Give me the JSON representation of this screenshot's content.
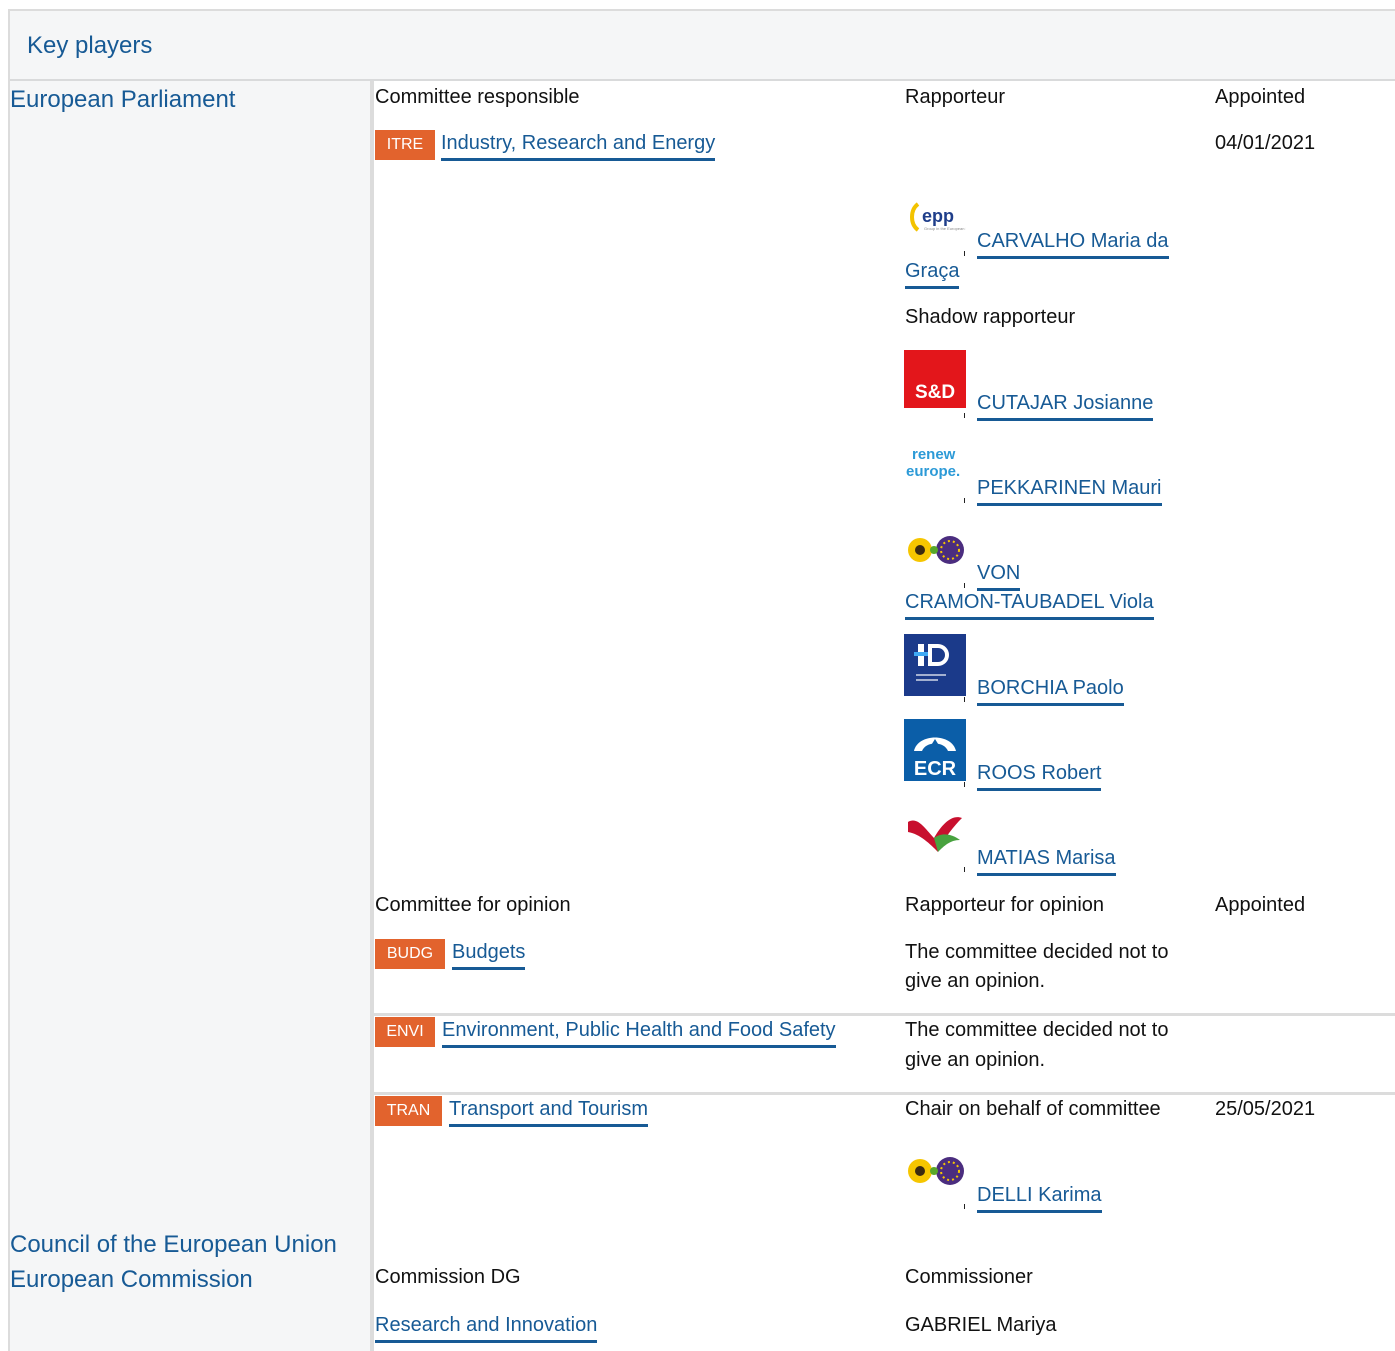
{
  "section": {
    "title": "Key players"
  },
  "bodies": {
    "ep": "European Parliament",
    "council": "Council of the European Union",
    "commission": "European Commission"
  },
  "responsible": {
    "headers": {
      "committee": "Committee responsible",
      "rapporteur": "Rapporteur",
      "appointed": "Appointed"
    },
    "committee": {
      "code": "ITRE",
      "name": "Industry, Research and Energy",
      "appointed": "04/01/2021"
    },
    "rapporteur": {
      "group": "epp-logo",
      "name_line1": "CARVALHO Maria da",
      "name_line2": "Graça"
    },
    "shadow_label": "Shadow rapporteur",
    "shadows": [
      {
        "group": "sd-logo",
        "logo_text": "S&D",
        "name": "CUTAJAR Josianne"
      },
      {
        "group": "renew-europe-logo",
        "logo_text_1": "renew",
        "logo_text_2": "europe.",
        "name": "PEKKARINEN Mauri"
      },
      {
        "group": "greens-efa-logo",
        "name_line1": "VON",
        "name_line2": "CRAMON-TAUBADEL Viola"
      },
      {
        "group": "id-logo",
        "name": "BORCHIA Paolo"
      },
      {
        "group": "ecr-logo",
        "logo_text": "ECR",
        "name": "ROOS Robert"
      },
      {
        "group": "left-logo",
        "name": "MATIAS Marisa"
      }
    ]
  },
  "opinion": {
    "headers": {
      "committee": "Committee for opinion",
      "rapporteur": "Rapporteur for opinion",
      "appointed": "Appointed"
    },
    "budg": {
      "code": "BUDG",
      "name": "Budgets",
      "status_line1": "The committee decided not to",
      "status_line2": "give an opinion."
    },
    "envi": {
      "code": "ENVI",
      "name": "Environment, Public Health and Food Safety",
      "status_line1": "The committee decided not to",
      "status_line2": "give an opinion."
    },
    "tran": {
      "code": "TRAN",
      "name": "Transport and Tourism",
      "role": "Chair on behalf of committee",
      "appointed": "25/05/2021",
      "person": "DELLI Karima",
      "group": "greens-efa-logo"
    }
  },
  "commission": {
    "headers": {
      "dg": "Commission DG",
      "commissioner": "Commissioner"
    },
    "dg": "Research and Innovation",
    "commissioner": "GABRIEL Mariya"
  },
  "colors": {
    "link": "#175a95",
    "badge": "#e2632d",
    "panel": "#f5f6f7",
    "divider": "#dcdcdc"
  }
}
